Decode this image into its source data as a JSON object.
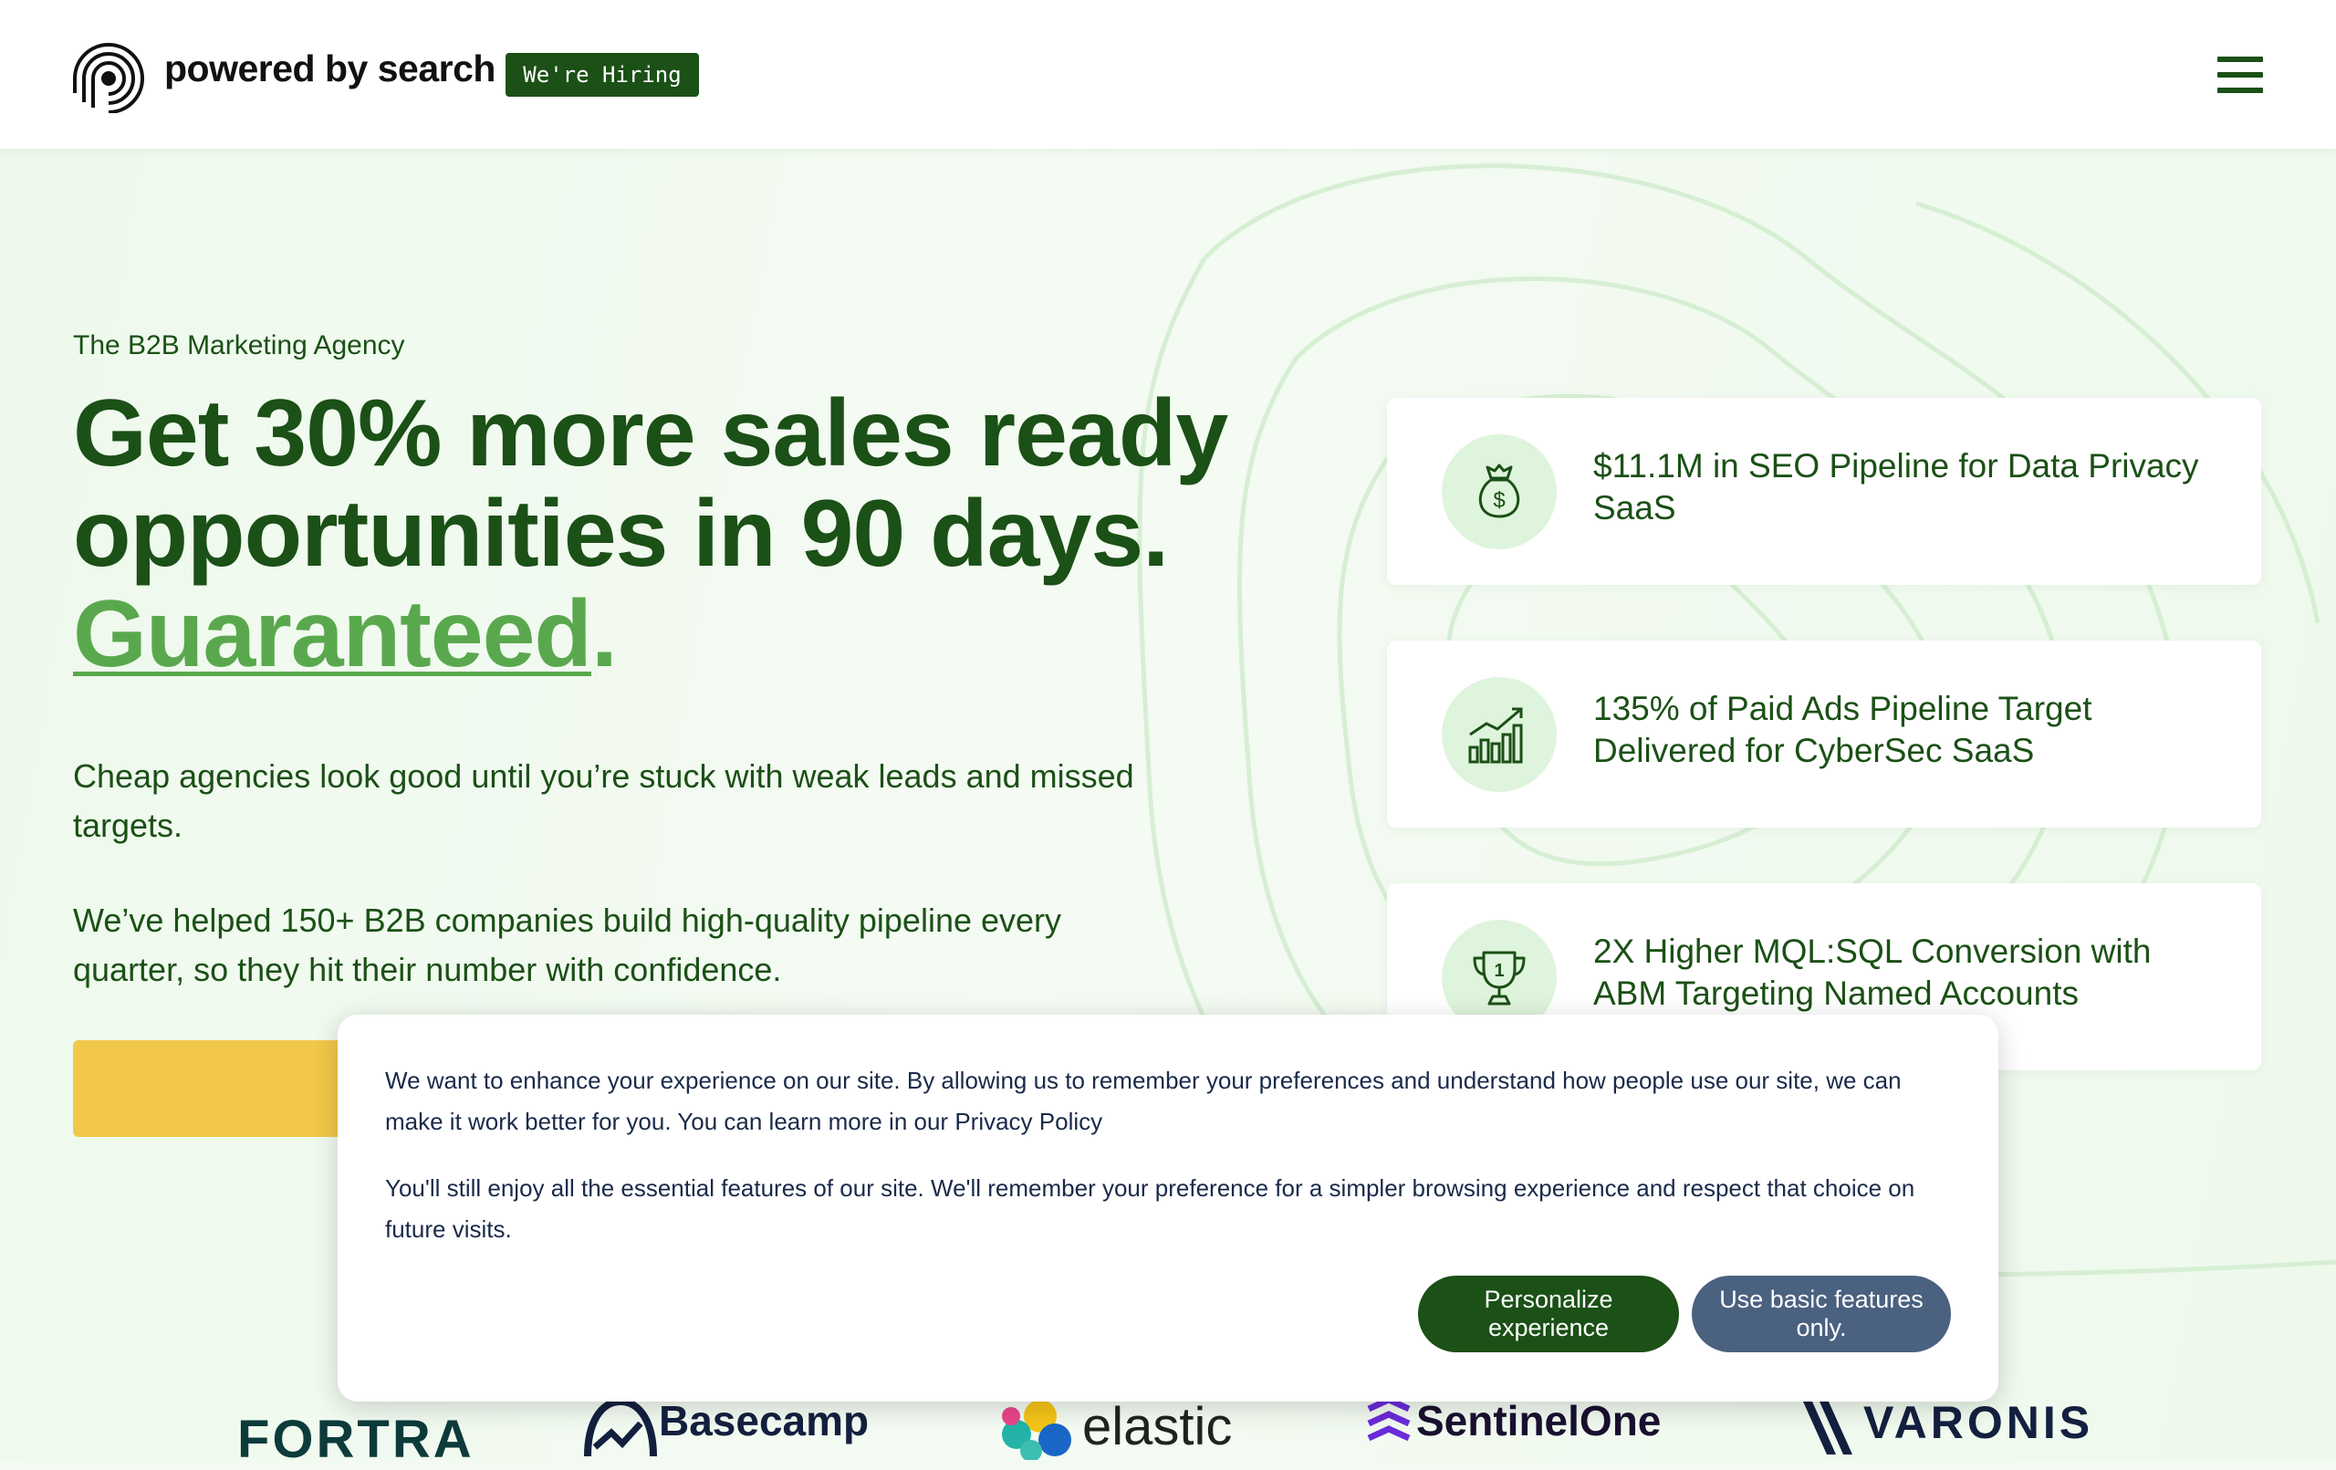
{
  "header": {
    "brand": "powered by search",
    "hiring_label": "We're Hiring"
  },
  "hero": {
    "eyebrow": "The B2B Marketing Agency",
    "headline_main": "Get 30% more sales ready opportunities in 90 days. ",
    "headline_accent": "Guaranteed",
    "headline_end": ".",
    "para1": "Cheap agencies look good until you’re stuck with weak leads and missed targets.",
    "para2": "We’ve helped 150+ B2B companies build high-quality pipeline every quarter, so they hit their number with confidence."
  },
  "results": [
    {
      "icon": "money-bag-icon",
      "text": "$11.1M in SEO Pipeline for Data Privacy SaaS"
    },
    {
      "icon": "bar-chart-icon",
      "text": "135% of Paid Ads Pipeline Target Delivered for CyberSec SaaS"
    },
    {
      "icon": "trophy-icon",
      "text": "2X Higher MQL:SQL Conversion with ABM Targeting Named Accounts"
    }
  ],
  "client_logos": [
    "FORTRA",
    "Basecamp",
    "elastic",
    "SentinelOne",
    "VARONIS"
  ],
  "cookie": {
    "para1": "We want to enhance your experience on our site. By allowing us to remember your preferences and understand how people use our site, we can make it work better for you. You can learn more in our Privacy Policy",
    "para2": "You'll still enjoy all the essential features of our site. We'll remember your preference for a simpler browsing experience and respect that choice on future visits.",
    "personalize_label": "Personalize experience",
    "basic_label": "Use basic features only."
  },
  "colors": {
    "brand_green": "#1b5016",
    "accent_green": "#5aa84e",
    "cta_yellow": "#f1c84a",
    "slate_button": "#4a6180"
  }
}
